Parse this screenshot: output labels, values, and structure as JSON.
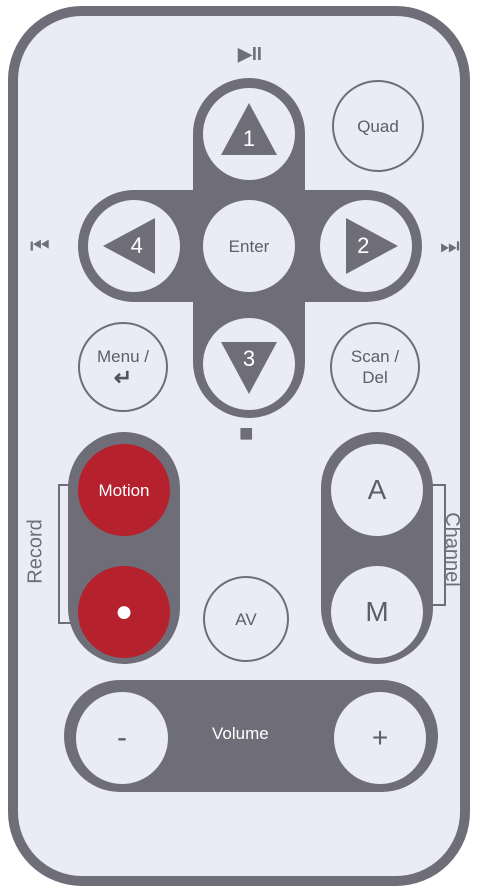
{
  "remote": {
    "top_icon": "▶II",
    "bottom_icon": "■",
    "left_icon": "⏮",
    "right_icon": "⏭",
    "dpad": {
      "up": "1",
      "down": "3",
      "left": "4",
      "right": "2",
      "center": "Enter"
    },
    "buttons": {
      "quad": "Quad",
      "menu_line1": "Menu /",
      "menu_line2": "↵",
      "scan_line1": "Scan /",
      "scan_line2": "Del",
      "motion": "Motion",
      "av": "AV",
      "channel_a": "A",
      "channel_m": "M",
      "volume_minus": "-",
      "volume_plus": "+",
      "record_dot": "●"
    },
    "labels": {
      "record": "Record",
      "channel": "Channel",
      "volume": "Volume"
    },
    "colors": {
      "body": "#e9ebf5",
      "frame": "#6e6d78",
      "record_red": "#b5212d"
    }
  }
}
